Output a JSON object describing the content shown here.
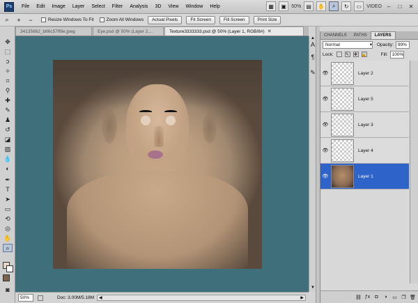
{
  "app": {
    "logo": "Ps",
    "menu": [
      "File",
      "Edit",
      "Image",
      "Layer",
      "Select",
      "Filter",
      "Analysis",
      "3D",
      "View",
      "Window",
      "Help"
    ],
    "zoom_menu": "50%",
    "workspace": "VIDEO",
    "window_controls": [
      "–",
      "□",
      "✕"
    ]
  },
  "options_bar": {
    "zoom_in": "+",
    "zoom_out": "−",
    "resize_windows": "Resize Windows To Fit",
    "zoom_all": "Zoom All Windows",
    "actual_pixels": "Actual Pixels",
    "fit_screen": "Fit Screen",
    "fill_screen": "Fill Screen",
    "print_size": "Print Size"
  },
  "tabs": [
    {
      "label": "34135862_b86c57ff8e.jpeg",
      "active": false
    },
    {
      "label": "Eye.psd @ 50% (Layer 2,...",
      "active": false
    },
    {
      "label": "Texture3333333.psd @ 50% (Layer 1, RGB/8#)",
      "active": true
    }
  ],
  "status": {
    "zoom": "50%",
    "doc": "Doc: 3.00M/5.18M"
  },
  "layers_panel": {
    "tabs": [
      "CHANNELS",
      "PATHS",
      "LAYERS"
    ],
    "blend_mode": "Normal",
    "opacity_label": "Opacity:",
    "opacity": "99%",
    "lock_label": "Lock:",
    "fill_label": "Fill:",
    "fill": "100%",
    "layers": [
      {
        "name": "Layer 2",
        "active": false
      },
      {
        "name": "Layer 5",
        "active": false
      },
      {
        "name": "Layer 3",
        "active": false
      },
      {
        "name": "Layer 4",
        "active": false
      },
      {
        "name": "Layer 1",
        "active": true
      }
    ]
  },
  "colors": {
    "canvas_bg": "#3f6f7a",
    "selected_layer": "#2e63c9"
  }
}
